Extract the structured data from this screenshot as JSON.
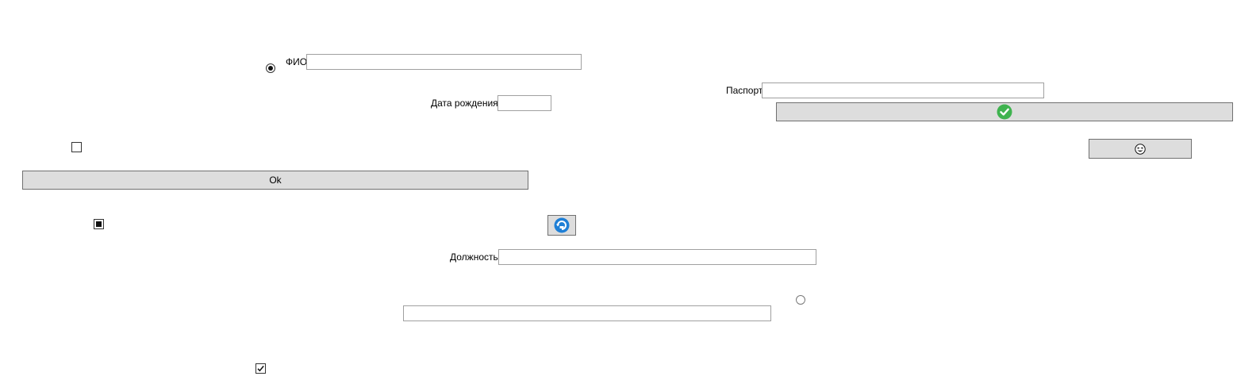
{
  "form": {
    "fio_label": "ФИО",
    "fio_value": "",
    "dob_label": "Дата рождения",
    "dob_value": "",
    "passport_label": "Паспорт",
    "passport_value": "",
    "position_label": "Должность",
    "position_value": "",
    "emoji_field_value": ""
  },
  "buttons": {
    "ok_label": "Ok",
    "confirm_icon": "green-check-circle-icon",
    "face_button_icon": "grinning-squint-face-icon",
    "refresh_icon": "blue-refresh-circle-icon"
  },
  "controls": {
    "fio_radio": "selected",
    "lower_radio": "unselected",
    "checkbox_top": "unchecked",
    "checkbox_middle": "indeterminate",
    "checkbox_bottom": "checked"
  },
  "colors": {
    "button_bg": "#dddddd",
    "field_border": "#a0a0a0",
    "confirm_green": "#3fb34f",
    "refresh_blue": "#1e7fd6"
  }
}
